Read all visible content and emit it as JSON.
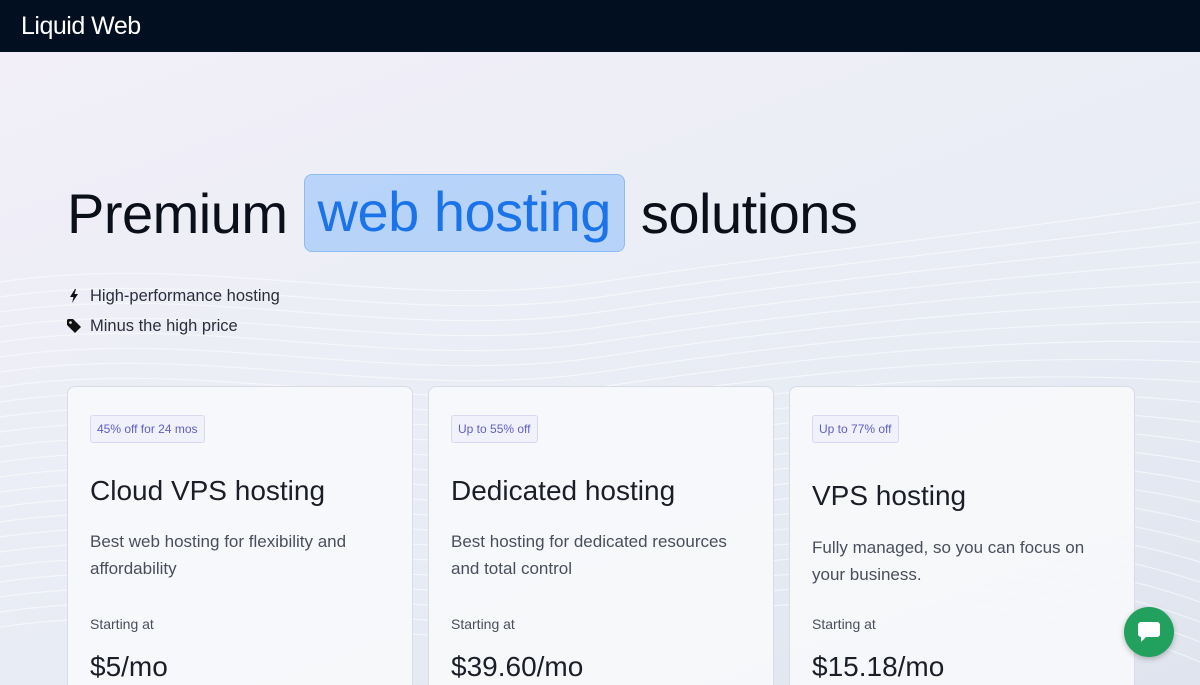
{
  "header": {
    "logo": "Liquid Web"
  },
  "hero": {
    "headline_before": "Premium",
    "headline_highlight": "web hosting",
    "headline_after": "solutions",
    "features": [
      {
        "icon": "lightning-icon",
        "label": "High-performance hosting"
      },
      {
        "icon": "tag-icon",
        "label": "Minus the high price"
      }
    ]
  },
  "cards": [
    {
      "badge": "45% off for 24 mos",
      "title": "Cloud VPS hosting",
      "description": "Best web hosting for flexibility and affordability",
      "starting_label": "Starting at",
      "price": "$5/mo"
    },
    {
      "badge": "Up to 55% off",
      "title": "Dedicated hosting",
      "description": "Best hosting for dedicated resources and total control",
      "starting_label": "Starting at",
      "price": "$39.60/mo"
    },
    {
      "badge": "Up to 77% off",
      "title": "VPS hosting",
      "description": "Fully managed, so you can focus on your business.",
      "starting_label": "Starting at",
      "price": "$15.18/mo"
    }
  ],
  "chat": {
    "icon": "chat-bubble-icon"
  },
  "colors": {
    "topbar": "#020f20",
    "highlight_text": "#1a73e8",
    "badge_text": "#5f5fc4",
    "chat_button": "#22a05d"
  }
}
